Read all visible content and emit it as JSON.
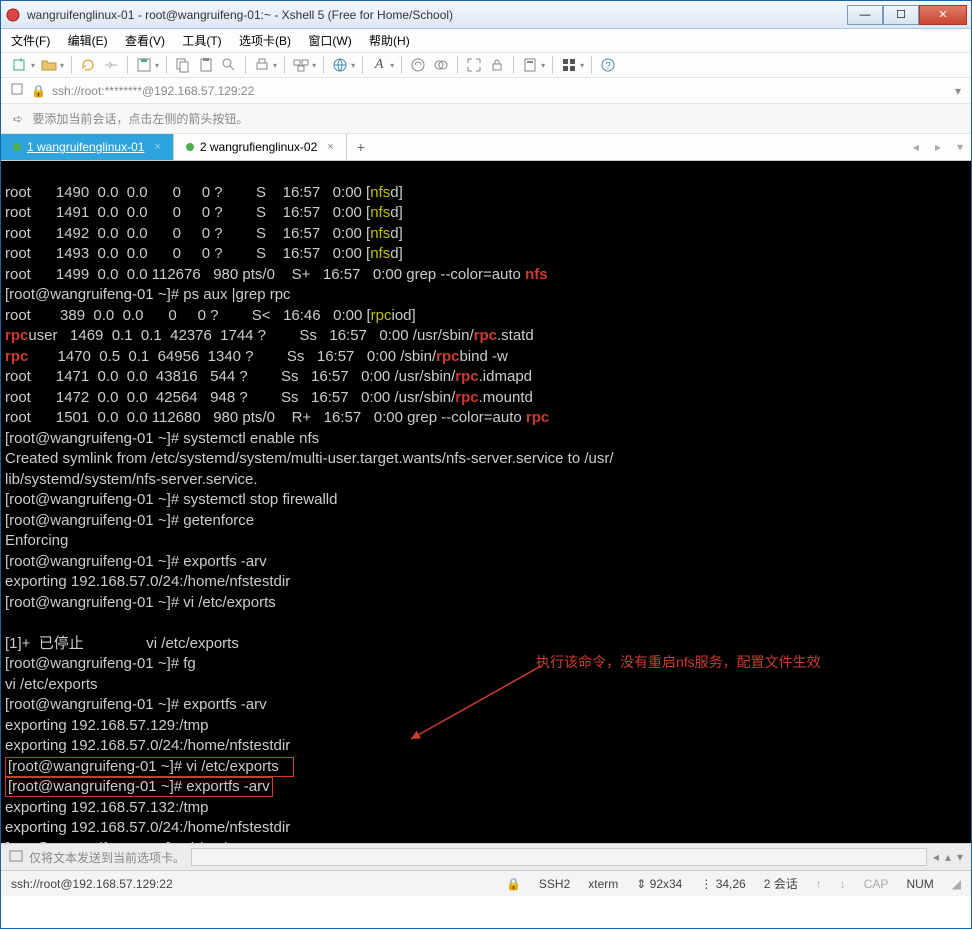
{
  "window": {
    "title": "wangruifenglinux-01 - root@wangruifeng-01:~ - Xshell 5 (Free for Home/School)"
  },
  "menu": {
    "file": "文件(F)",
    "edit": "编辑(E)",
    "view": "查看(V)",
    "tools": "工具(T)",
    "tabs": "选项卡(B)",
    "window": "窗口(W)",
    "help": "帮助(H)"
  },
  "addr": {
    "lock": "🔒",
    "url": "ssh://root:********@192.168.57.129:22"
  },
  "hint": {
    "text": "要添加当前会话，点击左侧的箭头按钮。"
  },
  "tabs": {
    "t1": {
      "label": "1 wangruifenglinux-01"
    },
    "t2": {
      "label": "2 wangrufienglinux-02"
    }
  },
  "term": {
    "l01": "root      1490  0.0  0.0      0     0 ?        S    16:57   0:00 [",
    "l01a": "nfs",
    "l01b": "d]",
    "l02": "root      1491  0.0  0.0      0     0 ?        S    16:57   0:00 [",
    "l03": "root      1492  0.0  0.0      0     0 ?        S    16:57   0:00 [",
    "l04": "root      1493  0.0  0.0      0     0 ?        S    16:57   0:00 [",
    "l05": "root      1499  0.0  0.0 112676   980 pts/0    S+   16:57   0:00 grep --color=auto ",
    "l05a": "nfs",
    "p1a": "[root@wangruifeng-01 ~]# ",
    "p1b": "ps aux |grep rpc",
    "l07": "root       389  0.0  0.0      0     0 ?        S<   16:46   0:00 [",
    "l07a": "rpc",
    "l07b": "iod]",
    "l08a": "rpc",
    "l08b": "user   1469  0.1  0.1  42376  1744 ?        Ss   16:57   0:00 /usr/sbin/",
    "l08c": "rpc",
    "l08d": ".statd",
    "l09a": "rpc",
    "l09b": "       1470  0.5  0.1  64956  1340 ?        Ss   16:57   0:00 /sbin/",
    "l09c": "rpc",
    "l09d": "bind -w",
    "l10": "root      1471  0.0  0.0  43816   544 ?        Ss   16:57   0:00 /usr/sbin/",
    "l10a": "rpc",
    "l10b": ".idmapd",
    "l11": "root      1472  0.0  0.0  42564   948 ?        Ss   16:57   0:00 /usr/sbin/",
    "l11a": "rpc",
    "l11b": ".mountd",
    "l12": "root      1501  0.0  0.0 112680   980 pts/0    R+   16:57   0:00 grep --color=auto ",
    "l12a": "rpc",
    "p2": "systemctl enable nfs",
    "l14": "Created symlink from /etc/systemd/system/multi-user.target.wants/nfs-server.service to /usr/",
    "l15": "lib/systemd/system/nfs-server.service.",
    "p3": "systemctl stop firewalld",
    "p4": "getenforce",
    "l18": "Enforcing",
    "p5": "exportfs -arv",
    "l20": "exporting 192.168.57.0/24:/home/nfstestdir",
    "p6": "vi /etc/exports",
    "l22": "",
    "l23": "[1]+  已停止               vi /etc/exports",
    "p7": "fg",
    "l25": "vi /etc/exports",
    "p8": "exportfs -arv",
    "l27": "exporting 192.168.57.129:/tmp",
    "l28": "exporting 192.168.57.0/24:/home/nfstestdir",
    "p9": "vi /etc/exports",
    "p10": "exportfs -arv",
    "l31": "exporting 192.168.57.132:/tmp",
    "l32": "exporting 192.168.57.0/24:/home/nfstestdir",
    "p11": "vi /etc/exports",
    "annotation": "执行该命令，没有重启nfs服务，配置文件生效"
  },
  "sendbar": {
    "label": "仅将文本发送到当前选项卡。"
  },
  "status": {
    "conn": "ssh://root@192.168.57.129:22",
    "ssh": "SSH2",
    "term": "xterm",
    "size": "92x34",
    "pos": "34,26",
    "sess": "2 会话",
    "cap": "CAP",
    "num": "NUM"
  }
}
